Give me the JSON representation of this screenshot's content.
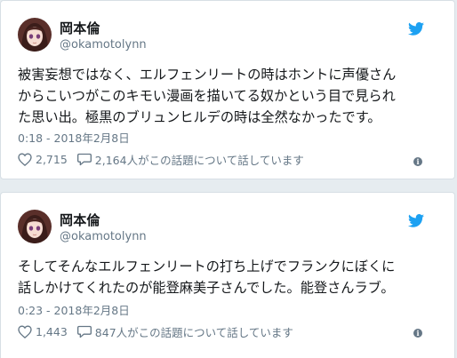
{
  "colors": {
    "background": "#e6ecf0",
    "card": "#ffffff",
    "text": "#14171a",
    "muted": "#657786",
    "twitter_blue": "#1da1f2"
  },
  "tweets": [
    {
      "display_name": "岡本倫",
      "screen_name": "@okamotolynn",
      "text": "被害妄想ではなく、エルフェンリートの時はホントに声優さん\nからこいつがこのキモい漫画を描いてる奴かという目で見られ\nた思い出。極黒のブリュンヒルデの時は全然なかったです。",
      "timestamp": "0:18 - 2018年2月8日",
      "likes": "2,715",
      "replies_text": "2,164人がこの話題について話しています",
      "icons": {
        "like": "heart-icon",
        "reply": "speech-bubble-icon",
        "brand": "twitter-bird-icon",
        "info": "info-icon"
      }
    },
    {
      "display_name": "岡本倫",
      "screen_name": "@okamotolynn",
      "text": "そしてそんなエルフェンリートの打ち上げでフランクにぼくに\n話しかけてくれたのが能登麻美子さんでした。能登さんラブ。",
      "timestamp": "0:23 - 2018年2月8日",
      "likes": "1,443",
      "replies_text": "847人がこの話題について話しています",
      "icons": {
        "like": "heart-icon",
        "reply": "speech-bubble-icon",
        "brand": "twitter-bird-icon",
        "info": "info-icon"
      }
    }
  ]
}
